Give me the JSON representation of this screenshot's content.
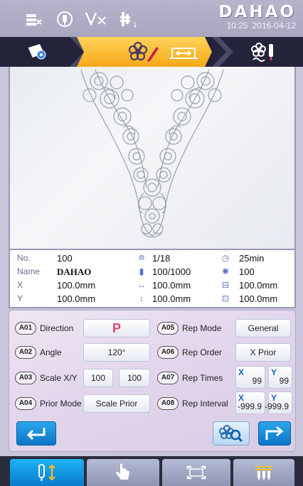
{
  "brand": {
    "name": "DAHAO",
    "time": "10:25",
    "date": "2016-04-12"
  },
  "status_icons": [
    "color-list-icon",
    "needle-stop-icon",
    "thread-break-icon",
    "needle-bar-icon"
  ],
  "tabs": [
    {
      "name": "tab-design-select",
      "icon": "design-icon",
      "active": false
    },
    {
      "name": "tab-design-edit",
      "icon": "edit-flower-icon",
      "active": true
    },
    {
      "name": "tab-frame-move",
      "icon": "frame-move-icon",
      "active": false
    },
    {
      "name": "tab-embroider",
      "icon": "embroider-icon",
      "active": false
    }
  ],
  "info": {
    "no_label": "No.",
    "no": "100",
    "name_label": "Name",
    "name": "DAHAO",
    "x_label": "X",
    "x": "100.0mm",
    "y_label": "Y",
    "y": "100.0mm",
    "colors": "1/18",
    "stitches": "100/1000",
    "width": "100.0mm",
    "height": "100.0mm",
    "time": "25min",
    "speed": "100",
    "frame_w": "100.0mm",
    "frame_h": "100.0mm"
  },
  "params": {
    "a01": {
      "code": "A01",
      "label": "Direction",
      "value": "P"
    },
    "a02": {
      "code": "A02",
      "label": "Angle",
      "value": "120°"
    },
    "a03": {
      "code": "A03",
      "label": "Scale X/Y",
      "x": "100",
      "y": "100"
    },
    "a04": {
      "code": "A04",
      "label": "Prior Mode",
      "value": "Scale Prior"
    },
    "a05": {
      "code": "A05",
      "label": "Rep Mode",
      "value": "General"
    },
    "a06": {
      "code": "A06",
      "label": "Rep Order",
      "value": "X Prior"
    },
    "a07": {
      "code": "A07",
      "label": "Rep Times",
      "x": "99",
      "y": "99"
    },
    "a08": {
      "code": "A08",
      "label": "Rep Interval",
      "x": "-999.9",
      "y": "-999.9"
    },
    "axis_x": "X",
    "axis_y": "Y"
  },
  "colors": {
    "accent_blue": "#0d76c8",
    "tab_active": "#f7a818",
    "direction_red": "#e5446d"
  }
}
